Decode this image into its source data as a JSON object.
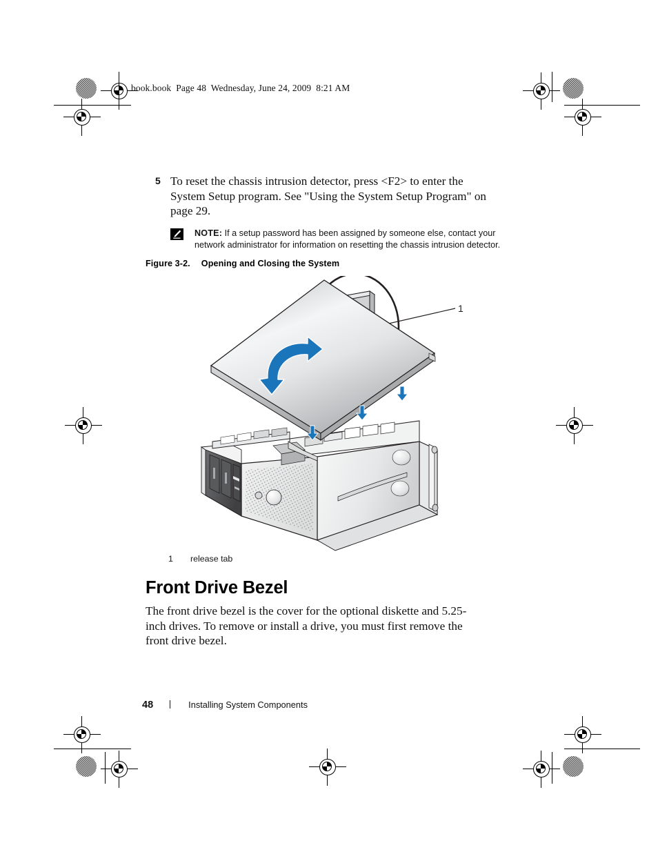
{
  "page": {
    "header_fileinfo": "book.book  Page 48  Wednesday, June 24, 2009  8:21 AM",
    "footer_page_number": "48",
    "footer_title": "Installing System Components"
  },
  "content": {
    "step": {
      "number": "5",
      "text": "To reset the chassis intrusion detector, press <F2> to enter the System Setup program. See \"Using the System Setup Program\" on page 29."
    },
    "note": {
      "icon": "note-pencil-icon",
      "label": "NOTE:",
      "text": " If a setup password has been assigned by someone else, contact your network administrator for information on resetting the chassis intrusion detector."
    }
  },
  "figure": {
    "caption_label": "Figure 3-2.",
    "caption_title": "Opening and Closing the System",
    "callout_number": "1",
    "legend": [
      {
        "number": "1",
        "label": "release tab"
      }
    ],
    "colors": {
      "accent_blue": "#1b75bb",
      "arrow_blue": "#1b75bb",
      "chassis_light": "#f2f2f2",
      "chassis_mid": "#d9d9d9",
      "chassis_dark": "#9a9a9a",
      "outline": "#231f20"
    }
  },
  "section": {
    "heading": "Front Drive Bezel",
    "paragraph": "The front drive bezel is the cover for the optional diskette and 5.25-inch drives. To remove or install a drive, you must first remove the front drive bezel."
  }
}
